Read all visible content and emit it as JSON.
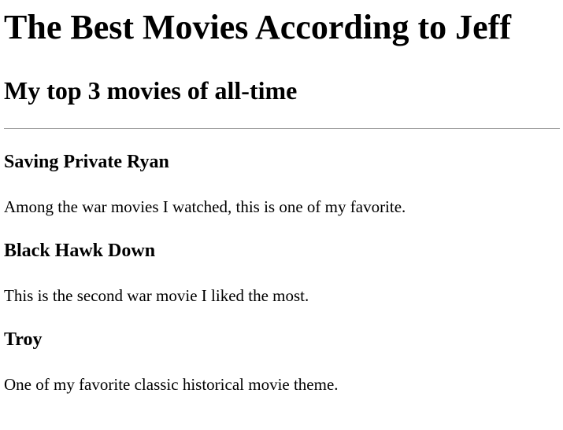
{
  "page": {
    "title": "The Best Movies According to Jeff",
    "subtitle": "My top 3 movies of all-time"
  },
  "movies": [
    {
      "name": "Saving Private Ryan",
      "description": "Among the war movies I watched, this is one of my favorite."
    },
    {
      "name": "Black Hawk Down",
      "description": "This is the second war movie I liked the most."
    },
    {
      "name": "Troy",
      "description": "One of my favorite classic historical movie theme."
    }
  ]
}
